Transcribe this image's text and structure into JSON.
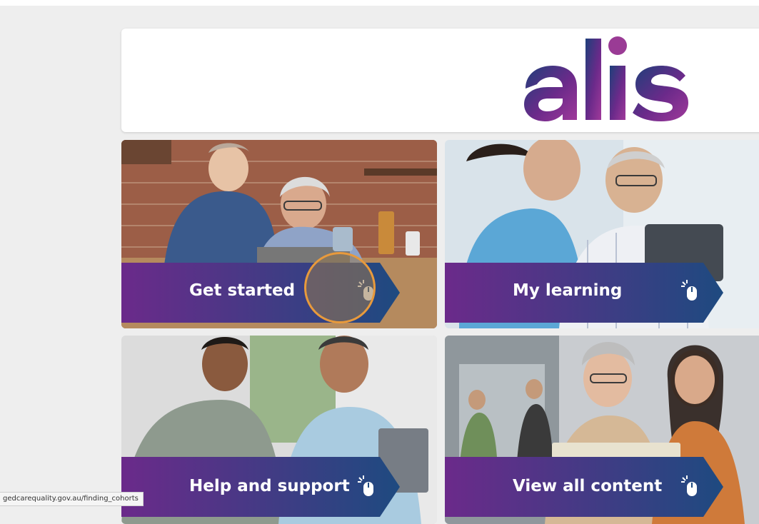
{
  "brand": {
    "logo_text": "alis",
    "colors": {
      "navy": "#1e3f7a",
      "purple": "#6b2a8a",
      "magenta": "#a0399a",
      "click_ring": "#e89a3c"
    }
  },
  "tiles": [
    {
      "label": "Get started",
      "icon": "mouse-click-icon"
    },
    {
      "label": "My learning",
      "icon": "mouse-click-icon"
    },
    {
      "label": "Help and support",
      "icon": "mouse-click-icon"
    },
    {
      "label": "View all content",
      "icon": "mouse-click-icon"
    }
  ],
  "status_bar": {
    "url": "gedcarequality.gov.au/finding_cohorts"
  }
}
